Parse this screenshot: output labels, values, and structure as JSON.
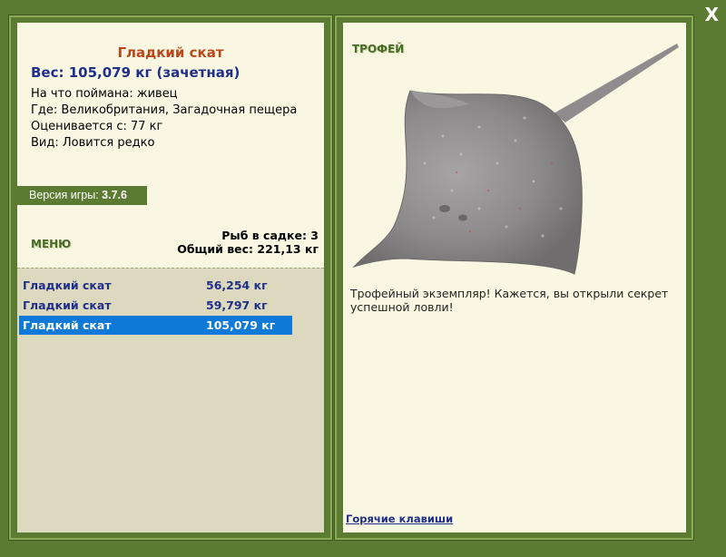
{
  "window": {
    "close_label": "X"
  },
  "fish": {
    "title": "Гладкий скат",
    "weight": "Вес: 105,079 кг (зачетная)",
    "info": [
      "На что поймана: живец",
      "Где: Великобритания, Загадочная пещера",
      "Оценивается с: 77 кг",
      "Вид: Ловится редко"
    ]
  },
  "version": {
    "label": "Версия игры:",
    "value": "3.7.6"
  },
  "menu": {
    "label": "МЕНЮ"
  },
  "keepnet": {
    "count": "Рыб в садке: 3",
    "total": "Общий вес: 221,13 кг"
  },
  "catch_list": [
    {
      "name": "Гладкий скат",
      "weight": "56,254 кг",
      "selected": false
    },
    {
      "name": "Гладкий скат",
      "weight": "59,797 кг",
      "selected": false
    },
    {
      "name": "Гладкий скат",
      "weight": "105,079 кг",
      "selected": true
    }
  ],
  "trophy": {
    "label": "ТРОФЕЙ",
    "text": "Трофейный экземпляр! Кажется, вы открыли секрет успешной ловли!",
    "image_icon": "stingray-image"
  },
  "footer": {
    "hotkeys_link": "Горячие клавиши"
  },
  "colors": {
    "frame": "#5b7b33",
    "panel": "#f9f7e1",
    "title": "#b8481c",
    "accent_text": "#1f2f8a",
    "selected_row": "#0e79d6"
  }
}
